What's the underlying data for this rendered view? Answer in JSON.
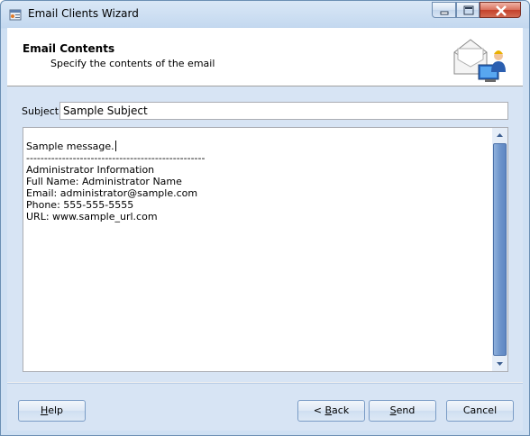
{
  "window": {
    "title": "Email Clients Wizard"
  },
  "header": {
    "title": "Email Contents",
    "subtitle": "Specify the contents of the email"
  },
  "form": {
    "subject_label": "Subject",
    "subject_value": "Sample Subject",
    "body_lines": [
      "Sample message.",
      "--------------------------------------------------",
      "Administrator Information",
      "Full Name: Administrator Name",
      "Email: administrator@sample.com",
      "Phone: 555-555-5555",
      "URL: www.sample_url.com"
    ]
  },
  "buttons": {
    "help": {
      "prefix": "",
      "accel": "H",
      "rest": "elp"
    },
    "back": {
      "prefix": "< ",
      "accel": "B",
      "rest": "ack"
    },
    "send": {
      "prefix": "",
      "accel": "S",
      "rest": "end"
    },
    "cancel": {
      "prefix": "",
      "accel": "",
      "rest": "Cancel"
    }
  },
  "icons": {
    "app": "wizard-app-icon",
    "minimize": "minimize-icon",
    "maximize": "maximize-icon",
    "close": "close-icon",
    "header": "email-user-computer-icon"
  }
}
